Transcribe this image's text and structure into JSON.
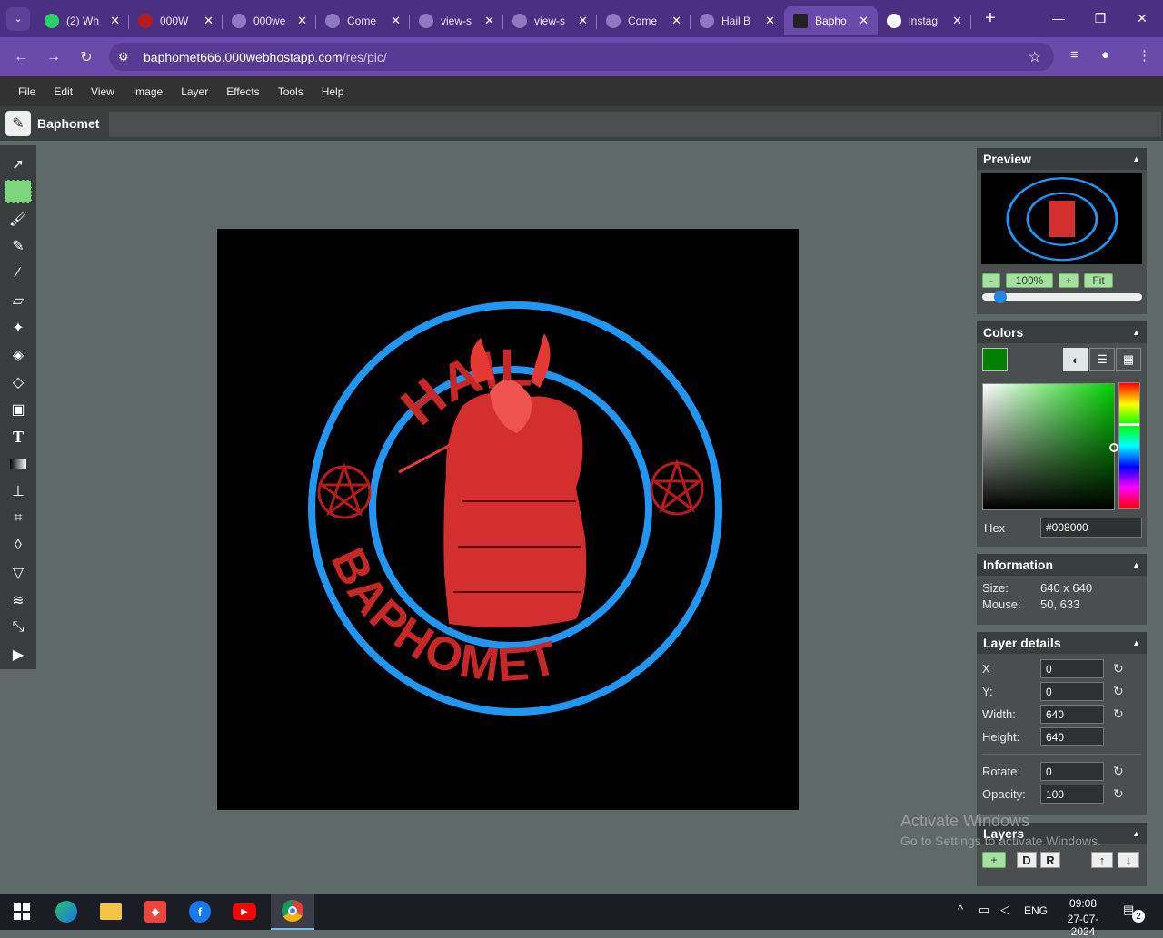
{
  "browser": {
    "tabs": [
      {
        "title": "(2) Wh",
        "favicon": "whatsapp-icon",
        "active": false
      },
      {
        "title": "000W",
        "favicon": "000webhost-icon",
        "active": false
      },
      {
        "title": "000we",
        "favicon": "globe-icon",
        "active": false
      },
      {
        "title": "Come",
        "favicon": "globe-icon",
        "active": false
      },
      {
        "title": "view-s",
        "favicon": "globe-icon",
        "active": false
      },
      {
        "title": "view-s",
        "favicon": "globe-icon",
        "active": false
      },
      {
        "title": "Come",
        "favicon": "globe-icon",
        "active": false
      },
      {
        "title": "Hail B",
        "favicon": "globe-icon",
        "active": false
      },
      {
        "title": "Bapho",
        "favicon": "baphomet-icon",
        "active": true
      },
      {
        "title": "instag",
        "favicon": "google-icon",
        "active": false
      }
    ],
    "url_host": "baphomet666.000webhostapp.com",
    "url_path": "/res/pic/"
  },
  "menu": [
    "File",
    "Edit",
    "View",
    "Image",
    "Layer",
    "Effects",
    "Tools",
    "Help"
  ],
  "app": {
    "name": "Baphomet"
  },
  "image": {
    "top_text": "HAIL",
    "bottom_text": "BAPHOMET",
    "ring_color": "#2196f3",
    "text_color": "#c62828",
    "figure_color": "#e53935"
  },
  "preview": {
    "title": "Preview",
    "minus": "-",
    "zoom": "100%",
    "plus": "+",
    "fit": "Fit",
    "zoom_value": 0.05
  },
  "colors": {
    "title": "Colors",
    "current": "#008000",
    "hex_label": "Hex",
    "hex_value": "#008000"
  },
  "information": {
    "title": "Information",
    "size_label": "Size:",
    "size_value": "640 x 640",
    "mouse_label": "Mouse:",
    "mouse_value": "50, 633"
  },
  "layer_details": {
    "title": "Layer details",
    "x_label": "X",
    "x_value": "0",
    "y_label": "Y:",
    "y_value": "0",
    "width_label": "Width:",
    "width_value": "640",
    "height_label": "Height:",
    "height_value": "640",
    "rotate_label": "Rotate:",
    "rotate_value": "0",
    "opacity_label": "Opacity:",
    "opacity_value": "100"
  },
  "layers": {
    "title": "Layers",
    "add": "+",
    "d": "D",
    "r": "R",
    "up": "↑",
    "down": "↓"
  },
  "watermark": {
    "line1": "Activate Windows",
    "line2": "Go to Settings to activate Windows."
  },
  "taskbar": {
    "lang": "ENG",
    "time": "09:08",
    "date": "27-07-2024",
    "notifications": "2"
  }
}
